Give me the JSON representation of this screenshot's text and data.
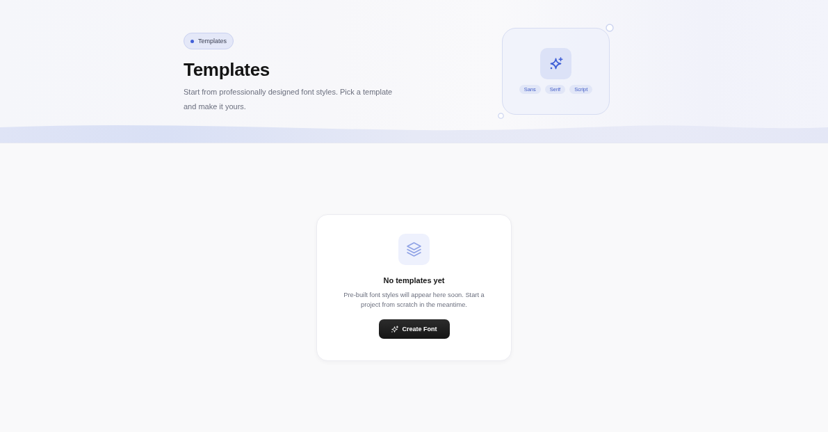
{
  "header": {
    "badge": "Templates",
    "title": "Templates",
    "subtitle": "Start from professionally designed font styles. Pick a template and make it yours.",
    "style_chips": [
      "Sans",
      "Serif",
      "Script"
    ]
  },
  "empty_state": {
    "title": "No templates yet",
    "description": "Pre-built font styles will appear here soon. Start a project from scratch in the meantime.",
    "button": "Create Font"
  }
}
